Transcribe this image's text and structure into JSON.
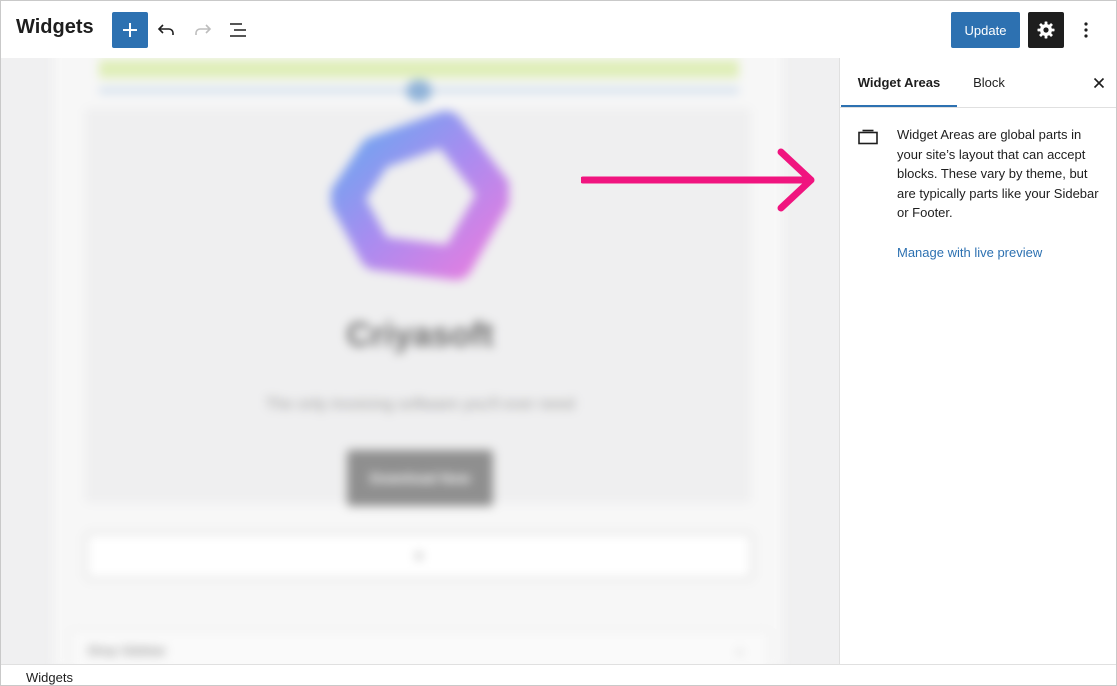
{
  "header": {
    "title": "Widgets",
    "add_icon": "plus-icon",
    "undo_icon": "undo-icon",
    "redo_icon": "redo-icon",
    "list_view_icon": "list-view-icon",
    "update_label": "Update",
    "settings_icon": "gear-icon",
    "more_icon": "more-vertical-icon"
  },
  "canvas": {
    "brand_name": "Criyasoft",
    "tagline": "The only invoicing software you'll ever need",
    "download_label": "Download Now",
    "appender_icon": "plus-icon",
    "bottom_section_label": "Shop Sidebar",
    "bottom_section_icon": "chevron-down-icon",
    "annotation_arrow_color": "#f0147f"
  },
  "sidebar": {
    "tabs": [
      {
        "label": "Widget Areas",
        "active": true
      },
      {
        "label": "Block",
        "active": false
      }
    ],
    "close_icon": "close-icon",
    "info_icon": "widget-area-icon",
    "description": "Widget Areas are global parts in your site’s layout that can accept blocks. These vary by theme, but are typically parts like your Sidebar or Footer.",
    "manage_link": "Manage with live preview"
  },
  "footer": {
    "breadcrumb": "Widgets"
  },
  "colors": {
    "accent": "#2d71b1",
    "dark_button": "#1e1e1e",
    "annotation": "#f0147f"
  }
}
